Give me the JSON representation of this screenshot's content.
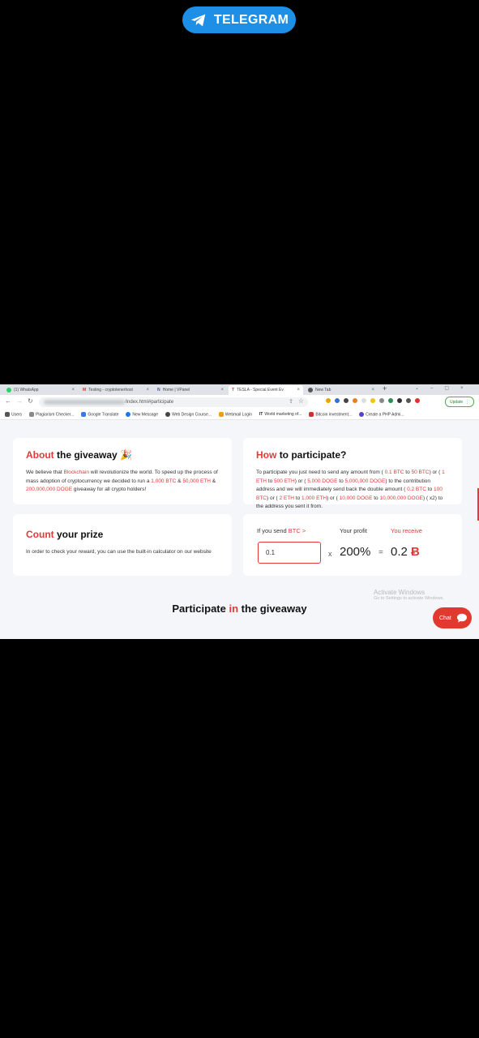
{
  "overlay": {
    "telegram_label": "TELEGRAM"
  },
  "browser": {
    "tabs": [
      {
        "label": "(1) WhatsApp"
      },
      {
        "label": "Testing - cryptotenerhost"
      },
      {
        "label": "Home | VPanel"
      },
      {
        "label": "TESLA - Special Event Ev"
      },
      {
        "label": "New Tab"
      }
    ],
    "new_tab_symbol": "+",
    "url": "/index.html#participate",
    "update_label": "Update",
    "bookmarks": [
      "Users",
      "Plagiarism Checker...",
      "Google Translate",
      "New Message",
      "Web Design Course...",
      "Webmail Login",
      "World marketing of...",
      "Bitcoin investment...",
      "Create a PHP Admi..."
    ]
  },
  "about": {
    "title_red": "About",
    "title_rest": "the giveaway",
    "emoji": "🎉",
    "text_1": "We believe that ",
    "text_link": "Blockchain",
    "text_2": " will revolutionize the world. To speed up the process of mass adoption of cryptocurrency we decided to run a ",
    "amt_btc": "1,000 BTC",
    "amp": " & ",
    "amt_eth": "50,000 ETH",
    "amp2": " & ",
    "amt_doge": "200,000,000 DOGE",
    "text_3": " giveaway for all crypto holders!"
  },
  "how": {
    "title_red": "How",
    "title_rest": "to participate?",
    "t1": "To participate you just need to send any amount from ( ",
    "r1": "0.1 BTC",
    "t2": " to ",
    "r2": "50 BTC",
    "t3": ") or ( ",
    "r3": "1 ETH",
    "t4": " to ",
    "r4": "500 ETH",
    "t5": ") or ( ",
    "r5": "5,000 DOGE",
    "t6": " to ",
    "r6": "5,000,000 DOGE",
    "t7": ") to the contribution address and we will immediately send back the double amount ( ",
    "r7": "0.2 BTC",
    "t8": " to ",
    "r8": "100 BTC",
    "t9": ") or ( ",
    "r9": "2 ETH",
    "t10": " to ",
    "r10": "1,000 ETH",
    "t11": ") or ( ",
    "r11": "10,000 DOGE",
    "t12": " to ",
    "r12": "10,000,000 DOGE",
    "t13": ") ( x2) to the address you sent it from."
  },
  "count": {
    "title_red": "Count",
    "title_rest": "your prize",
    "text": "In order to check your reward, you can use the built-in calculator on our website"
  },
  "calculator": {
    "send_label": "If you send ",
    "send_currency": "BTC >",
    "profit_label": "Your profit",
    "receive_label": "You receive",
    "input_value": "0.1",
    "times": "x",
    "profit_value": "200%",
    "equals": "=",
    "receive_value": "0.2",
    "currency_symbol": "Ƀ"
  },
  "participate": {
    "pre": "Participate ",
    "red": "in",
    "post": " the giveaway"
  },
  "watermark": {
    "line1": "Activate Windows",
    "line2": "Go to Settings to activate Windows."
  },
  "chat": {
    "label": "Chat"
  },
  "colors": {
    "accent": "#e0393a",
    "telegram": "#1d8fe6"
  }
}
